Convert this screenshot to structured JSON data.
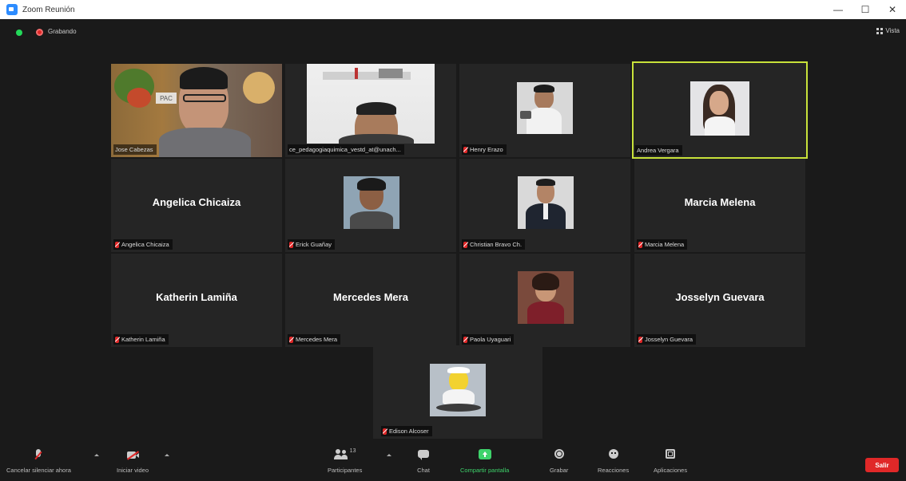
{
  "window": {
    "title": "Zoom Reunión",
    "minimize": "—",
    "maximize": "☐",
    "close": "✕"
  },
  "meeting": {
    "recording_label": "Grabando",
    "view_label": "Vista"
  },
  "participants": [
    {
      "name": "Jose Cabezas",
      "overlay": "PAC",
      "video": true,
      "active": false
    },
    {
      "name": "ce_pedagogiaquimica_vestd_at@unach...",
      "video": true,
      "active": false
    },
    {
      "name": "Henry Erazo",
      "video": true,
      "active": false
    },
    {
      "name": "Andrea Vergara",
      "video": true,
      "active": true
    },
    {
      "name": "Angelica Chicaiza",
      "display": "Angelica Chicaiza",
      "video": false,
      "active": false
    },
    {
      "name": "Erick Guañay",
      "video": true,
      "active": false
    },
    {
      "name": "Christian Bravo Ch.",
      "video": true,
      "active": false
    },
    {
      "name": "Marcia Melena",
      "display": "Marcia Melena",
      "video": false,
      "active": false
    },
    {
      "name": "Katherin Lamiña",
      "display": "Katherin Lamiña",
      "video": false,
      "active": false
    },
    {
      "name": "Mercedes Mera",
      "display": "Mercedes Mera",
      "video": false,
      "active": false
    },
    {
      "name": "Paola Uyaguari",
      "video": true,
      "active": false
    },
    {
      "name": "Josselyn Guevara",
      "display": "Josselyn Guevara",
      "video": false,
      "active": false
    },
    {
      "name": "Edison Alcoser",
      "video": true,
      "active": false
    }
  ],
  "toolbar": {
    "mute_label": "Cancelar silenciar ahora",
    "video_label": "Iniciar video",
    "participants_label": "Participantes",
    "participants_count": "13",
    "chat_label": "Chat",
    "share_label": "Compartir pantalla",
    "record_label": "Grabar",
    "reactions_label": "Reacciones",
    "apps_label": "Aplicaciones",
    "leave_label": "Salir"
  },
  "colors": {
    "background": "#1a1a1a",
    "tile": "#252525",
    "active_speaker": "#c8e23a",
    "leave": "#e02828",
    "share": "#3ed36b"
  }
}
